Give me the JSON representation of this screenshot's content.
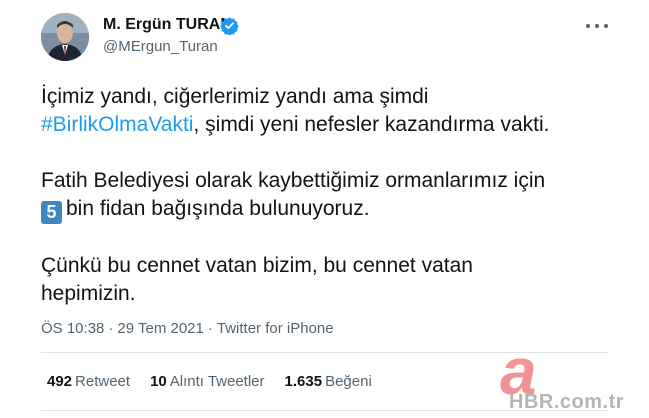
{
  "author": {
    "display_name": "M. Ergün TURAN",
    "handle": "@MErgun_Turan",
    "verified": true,
    "avatar": "avatar-portrait-icon"
  },
  "tweet": {
    "line1": "İçimiz yandı, ciğerlerimiz yandı ama şimdi",
    "hashtag": "#BirlikOlmaVakti",
    "line2_rest": ", şimdi yeni nefesler kazandırma vakti.",
    "line3": "Fatih Belediyesi olarak kaybettiğimiz ormanlarımız için",
    "keycap": "5",
    "line4_rest": "bin fidan bağışında bulunuyoruz.",
    "line5": "Çünkü bu cennet vatan bizim, bu cennet vatan",
    "line6": "hepimizin."
  },
  "meta": {
    "time": "ÖS 10:38",
    "date": "29 Tem 2021",
    "separator": "·",
    "source": "Twitter for iPhone"
  },
  "stats": {
    "retweets_count": "492",
    "retweets_label": "Retweet",
    "quotes_count": "10",
    "quotes_label": "Alıntı Tweetler",
    "likes_count": "1.635",
    "likes_label": "Beğeni"
  },
  "watermark": {
    "logo_letter": "a",
    "site": "HBR.com.tr"
  },
  "colors": {
    "link": "#1d9bf0",
    "verified": "#1d9bf0",
    "secondary_text": "#536471",
    "keycap": "#3b88c3"
  }
}
